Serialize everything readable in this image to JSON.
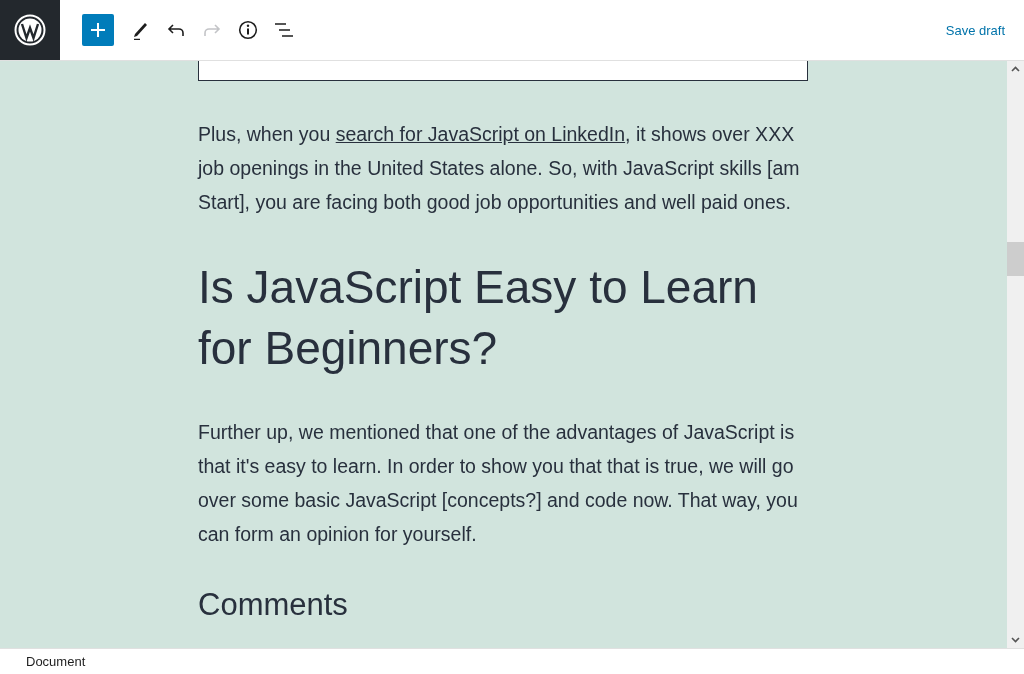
{
  "toolbar": {
    "undo": {
      "disabled": false
    },
    "redo": {
      "disabled": true
    },
    "save": "Save draft"
  },
  "content": [
    {
      "kind": "paragraph",
      "before": "Plus, when you ",
      "link": "search for JavaScript on LinkedIn",
      "after": ", it shows over XXX job openings in the United States alone. So, with JavaScript skills [am Start], you are facing both good job opportunities and well paid ones."
    },
    {
      "kind": "heading",
      "text": "Is JavaScript Easy to Learn for Beginners?"
    },
    {
      "kind": "paragraph",
      "before": "Further up, we mentioned that one of the advantages of JavaScript is that it's easy to learn. In order to show you that that is true, we will go over some basic JavaScript [concepts?] and code now. That way, you can form an opinion for yourself."
    },
    {
      "kind": "subheading",
      "text": "Comments"
    }
  ],
  "status_bar": {
    "breadcrumb": "Document"
  }
}
